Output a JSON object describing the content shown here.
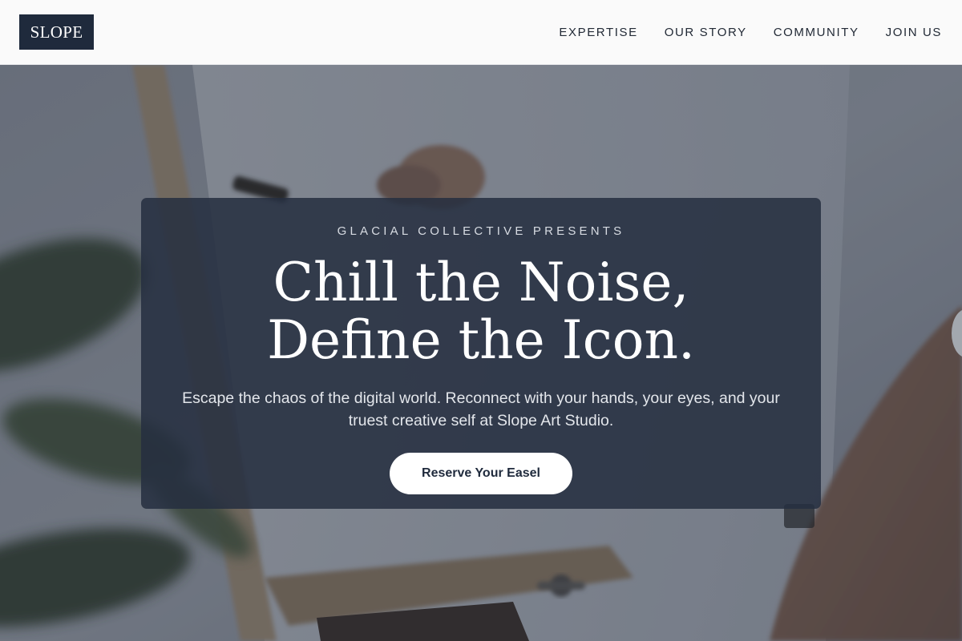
{
  "header": {
    "logo_text": "SLOPE",
    "nav": [
      {
        "label": "EXPERTISE"
      },
      {
        "label": "OUR STORY"
      },
      {
        "label": "COMMUNITY"
      },
      {
        "label": "JOIN US"
      }
    ]
  },
  "hero": {
    "eyebrow": "GLACIAL COLLECTIVE PRESENTS",
    "headline_line1": "Chill the Noise,",
    "headline_line2": "Define the Icon.",
    "subtext": "Escape the chaos of the digital world. Reconnect with your hands, your eyes, and your truest creative self at Slope Art Studio.",
    "cta_label": "Reserve Your Easel"
  },
  "colors": {
    "brand_navy": "#1f2a3c",
    "header_bg": "#fafafa",
    "card_bg": "#252f40",
    "cta_bg": "#ffffff"
  }
}
